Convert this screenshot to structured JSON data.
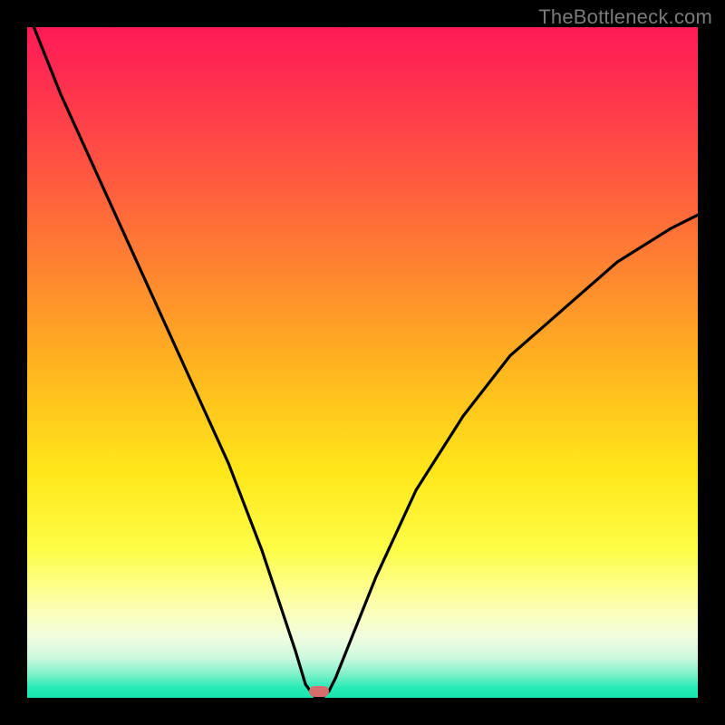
{
  "watermark": "TheBottleneck.com",
  "chart_data": {
    "type": "line",
    "title": "",
    "xlabel": "",
    "ylabel": "",
    "xlim": [
      0,
      100
    ],
    "ylim": [
      0,
      100
    ],
    "grid": false,
    "background": {
      "gradient_direction": "vertical",
      "stops": [
        {
          "pos": 0,
          "color": "#ff1a56"
        },
        {
          "pos": 22,
          "color": "#ff5740"
        },
        {
          "pos": 52,
          "color": "#ffb91e"
        },
        {
          "pos": 78,
          "color": "#fdfd47"
        },
        {
          "pos": 94,
          "color": "#cdf9de"
        },
        {
          "pos": 100,
          "color": "#17e6b0"
        }
      ]
    },
    "series": [
      {
        "name": "bottleneck-curve",
        "color": "#000000",
        "x": [
          1,
          5,
          10,
          15,
          20,
          25,
          30,
          35,
          38,
          40,
          41.5,
          43,
          44,
          45,
          46,
          48,
          52,
          58,
          65,
          72,
          80,
          88,
          96,
          100
        ],
        "y": [
          100,
          90,
          79,
          68,
          57,
          46,
          35,
          22,
          13,
          7,
          2,
          0,
          0,
          1,
          3,
          8,
          18,
          31,
          42,
          51,
          58,
          65,
          70,
          72
        ]
      }
    ],
    "marker": {
      "name": "optimal-point",
      "x": 43.5,
      "y": 1,
      "color": "#d76d6d",
      "shape": "rounded-rect"
    }
  }
}
